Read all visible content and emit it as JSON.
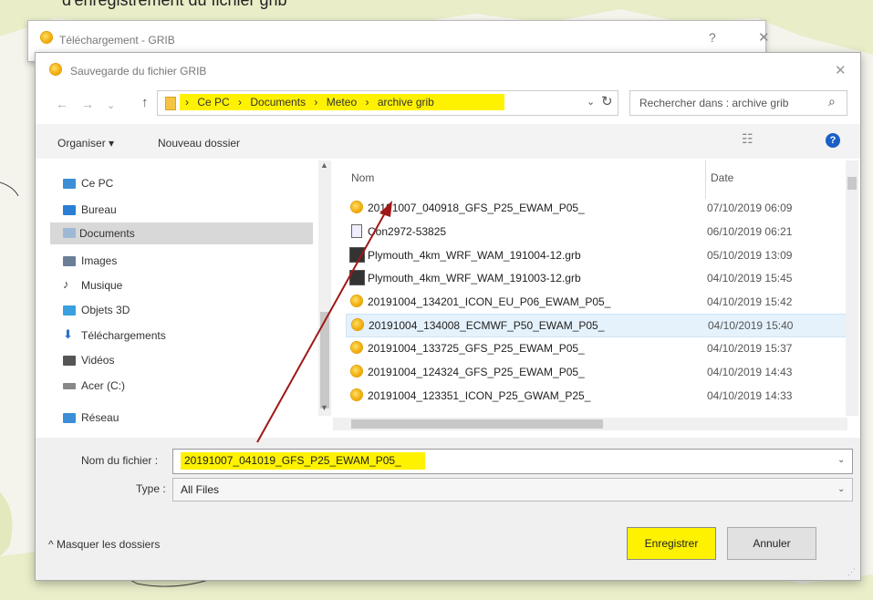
{
  "caption": "d'enregistrement du fichier grib",
  "outer_window": {
    "title": "Téléchargement - GRIB",
    "help": "?",
    "close": "✕"
  },
  "dialog": {
    "title": "Sauvegarde du fichier GRIB",
    "close": "✕"
  },
  "address_bar": {
    "back": "←",
    "forward": "→",
    "recent": "⌄",
    "up": "↑",
    "crumbs": [
      "›",
      "Ce PC",
      "›",
      "Documents",
      "›",
      "Meteo",
      "›",
      "archive grib"
    ],
    "dropdown": "⌄",
    "refresh": "↻"
  },
  "search": {
    "placeholder": "Rechercher dans : archive grib",
    "icon": "search-icon",
    "glyph": "⌕"
  },
  "toolbar": {
    "organize": "Organiser ▾",
    "new_folder": "Nouveau dossier",
    "view": "☷",
    "view_dd": "▾",
    "help": "?"
  },
  "sidebar": {
    "items": [
      {
        "label": "Ce PC",
        "icon": "pc-icon",
        "color": "#3c8fd6"
      },
      {
        "label": "Bureau",
        "icon": "desktop-icon",
        "color": "#2a7fd4"
      },
      {
        "label": "Documents",
        "icon": "documents-icon",
        "color": "#9fb8d6"
      },
      {
        "label": "Images",
        "icon": "images-icon",
        "color": "#6a7f96"
      },
      {
        "label": "Musique",
        "icon": "music-icon",
        "color": "#444444"
      },
      {
        "label": "Objets 3D",
        "icon": "objects3d-icon",
        "color": "#3aa0e0"
      },
      {
        "label": "Téléchargements",
        "icon": "downloads-icon",
        "color": "#2a6fd0"
      },
      {
        "label": "Vidéos",
        "icon": "videos-icon",
        "color": "#555555"
      },
      {
        "label": "Acer (C:)",
        "icon": "drive-icon",
        "color": "#888888"
      },
      {
        "label": "Réseau",
        "icon": "network-icon",
        "color": "#3c8fd6"
      }
    ]
  },
  "columns": {
    "name": "Nom",
    "date": "Date"
  },
  "files": [
    {
      "name": "20191007_040918_GFS_P25_EWAM_P05_",
      "date": "07/10/2019 06:09",
      "icon": "grib-icon"
    },
    {
      "name": "Con2972-53825",
      "date": "06/10/2019 06:21",
      "icon": "document-icon"
    },
    {
      "name": "Plymouth_4km_WRF_WAM_191004-12.grb",
      "date": "05/10/2019 13:09",
      "icon": "image-file-icon"
    },
    {
      "name": "Plymouth_4km_WRF_WAM_191003-12.grb",
      "date": "04/10/2019 15:45",
      "icon": "image-file-icon"
    },
    {
      "name": "20191004_134201_ICON_EU_P06_EWAM_P05_",
      "date": "04/10/2019 15:42",
      "icon": "grib-icon"
    },
    {
      "name": "20191004_134008_ECMWF_P50_EWAM_P05_",
      "date": "04/10/2019 15:40",
      "icon": "grib-icon"
    },
    {
      "name": "20191004_133725_GFS_P25_EWAM_P05_",
      "date": "04/10/2019 15:37",
      "icon": "grib-icon"
    },
    {
      "name": "20191004_124324_GFS_P25_EWAM_P05_",
      "date": "04/10/2019 14:43",
      "icon": "grib-icon"
    },
    {
      "name": "20191004_123351_ICON_P25_GWAM_P25_",
      "date": "04/10/2019 14:33",
      "icon": "grib-icon"
    }
  ],
  "form": {
    "filename_label": "Nom du fichier :",
    "filename_value": "20191007_041019_GFS_P25_EWAM_P05_",
    "type_label": "Type :",
    "type_value": "All Files",
    "dropdown": "⌄"
  },
  "footer": {
    "hide_folders": "^ Masquer les dossiers",
    "save": "Enregistrer",
    "cancel": "Annuler"
  },
  "colors": {
    "highlight": "#fff200",
    "selected_row": "#e5f1fb",
    "arrow": "#a01818",
    "help_icon": "#1a5fc6"
  }
}
